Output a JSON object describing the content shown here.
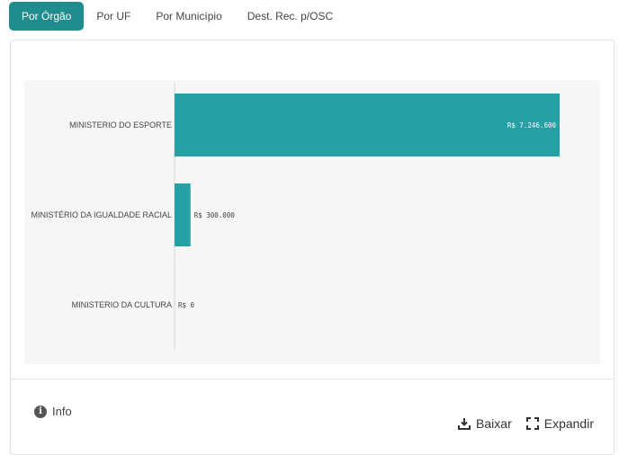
{
  "tabs": [
    {
      "label": "Por Órgão",
      "active": true
    },
    {
      "label": "Por UF",
      "active": false
    },
    {
      "label": "Por Município",
      "active": false
    },
    {
      "label": "Dest. Rec. p/OSC",
      "active": false
    }
  ],
  "chart_data": {
    "type": "bar",
    "orientation": "horizontal",
    "categories": [
      "MINISTERIO DO ESPORTE",
      "MINISTÉRIO DA IGUALDADE RACIAL",
      "MINISTERIO DA CULTURA"
    ],
    "values": [
      7246600,
      300000,
      0
    ],
    "value_labels": [
      "R$ 7.246.600",
      "R$ 300.000",
      "R$ 0"
    ],
    "bar_color": "#26a0a4",
    "xlim": [
      0,
      7246600
    ]
  },
  "footer": {
    "info_label": "Info",
    "download_label": "Baixar",
    "expand_label": "Expandir"
  }
}
